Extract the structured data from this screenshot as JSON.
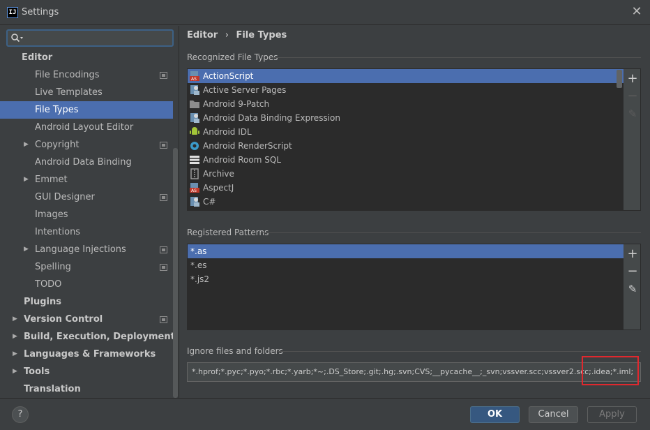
{
  "window": {
    "title": "Settings",
    "app_icon_text": "IJ"
  },
  "search": {
    "placeholder": "",
    "value": ""
  },
  "sidebar": {
    "items": [
      {
        "label": "Editor",
        "level": 0,
        "bold": true,
        "arrow": "",
        "project": false
      },
      {
        "label": "File Encodings",
        "level": 1,
        "bold": false,
        "arrow": "",
        "project": true
      },
      {
        "label": "Live Templates",
        "level": 1,
        "bold": false,
        "arrow": "",
        "project": false
      },
      {
        "label": "File Types",
        "level": 1,
        "bold": false,
        "arrow": "",
        "project": false,
        "selected": true
      },
      {
        "label": "Android Layout Editor",
        "level": 1,
        "bold": false,
        "arrow": "",
        "project": false
      },
      {
        "label": "Copyright",
        "level": 1,
        "bold": false,
        "arrow": "▶",
        "project": true
      },
      {
        "label": "Android Data Binding",
        "level": 1,
        "bold": false,
        "arrow": "",
        "project": false
      },
      {
        "label": "Emmet",
        "level": 1,
        "bold": false,
        "arrow": "▶",
        "project": false
      },
      {
        "label": "GUI Designer",
        "level": 1,
        "bold": false,
        "arrow": "",
        "project": true
      },
      {
        "label": "Images",
        "level": 1,
        "bold": false,
        "arrow": "",
        "project": false
      },
      {
        "label": "Intentions",
        "level": 1,
        "bold": false,
        "arrow": "",
        "project": false
      },
      {
        "label": "Language Injections",
        "level": 1,
        "bold": false,
        "arrow": "▶",
        "project": true
      },
      {
        "label": "Spelling",
        "level": 1,
        "bold": false,
        "arrow": "",
        "project": true
      },
      {
        "label": "TODO",
        "level": 1,
        "bold": false,
        "arrow": "",
        "project": false
      },
      {
        "label": "Plugins",
        "level": 0,
        "bold": true,
        "arrow": "",
        "project": false
      },
      {
        "label": "Version Control",
        "level": 0,
        "bold": true,
        "arrow": "▶",
        "project": true
      },
      {
        "label": "Build, Execution, Deployment",
        "level": 0,
        "bold": true,
        "arrow": "▶",
        "project": false
      },
      {
        "label": "Languages & Frameworks",
        "level": 0,
        "bold": true,
        "arrow": "▶",
        "project": false
      },
      {
        "label": "Tools",
        "level": 0,
        "bold": true,
        "arrow": "▶",
        "project": false
      },
      {
        "label": "Translation",
        "level": 0,
        "bold": true,
        "arrow": "",
        "project": false
      }
    ]
  },
  "breadcrumb": {
    "parent": "Editor",
    "separator": "›",
    "current": "File Types"
  },
  "recognized": {
    "title": "Recognized File Types",
    "items": [
      {
        "label": "ActionScript",
        "icon": "actionscript-icon",
        "color": "#c0392b",
        "selected": true
      },
      {
        "label": "Active Server Pages",
        "icon": "asp-icon",
        "color": "#6a8fb0"
      },
      {
        "label": "Android 9-Patch",
        "icon": "folder-icon",
        "color": "#8c8c8c"
      },
      {
        "label": "Android Data Binding Expression",
        "icon": "databinding-icon",
        "color": "#6a8fb0"
      },
      {
        "label": "Android IDL",
        "icon": "android-icon",
        "color": "#a4c639"
      },
      {
        "label": "Android RenderScript",
        "icon": "renderscript-icon",
        "color": "#3b9ac9"
      },
      {
        "label": "Android Room SQL",
        "icon": "room-sql-icon",
        "color": "#e0e0e0"
      },
      {
        "label": "Archive",
        "icon": "archive-icon",
        "color": "#9a9a9a"
      },
      {
        "label": "AspectJ",
        "icon": "aspectj-icon",
        "color": "#c0392b"
      },
      {
        "label": "C#",
        "icon": "csharp-icon",
        "color": "#6a8fb0"
      }
    ]
  },
  "patterns": {
    "title": "Registered Patterns",
    "items": [
      {
        "label": "*.as",
        "selected": true
      },
      {
        "label": "*.es"
      },
      {
        "label": "*.js2"
      }
    ]
  },
  "ignore": {
    "title": "Ignore files and folders",
    "value": "*.hprof;*.pyc;*.pyo;*.rbc;*.yarb;*~;.DS_Store;.git;.hg;.svn;CVS;__pycache__;_svn;vssver.scc;vssver2.scc;.idea;*.iml;"
  },
  "tools": {
    "add": "+",
    "remove": "−",
    "edit": "✎"
  },
  "footer": {
    "help": "?",
    "ok": "OK",
    "cancel": "Cancel",
    "apply": "Apply"
  },
  "colors": {
    "selection": "#4b6eaf",
    "background": "#3c3f41",
    "list_background": "#2b2b2b",
    "highlight": "#e0282e",
    "ok_button": "#365880"
  }
}
